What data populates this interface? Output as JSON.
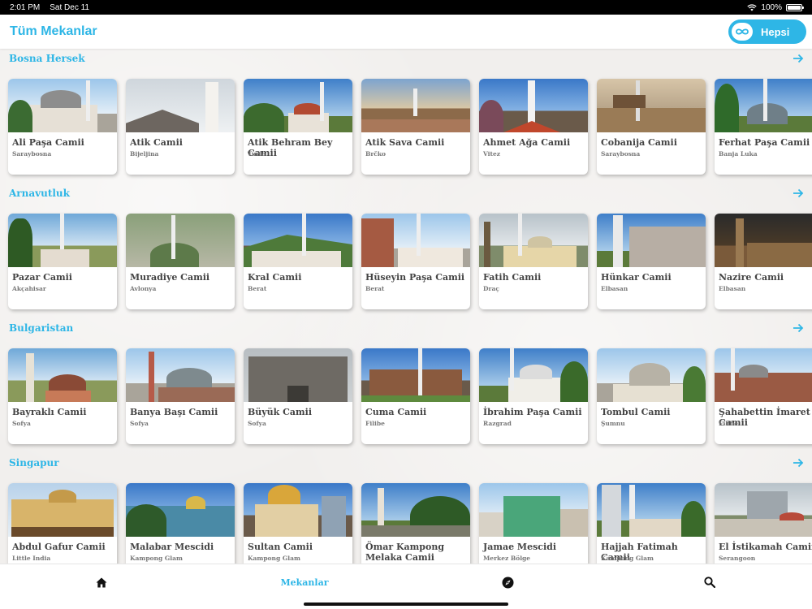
{
  "status": {
    "time": "2:01 PM",
    "date": "Sat Dec 11",
    "battery": "100%"
  },
  "header": {
    "title": "Tüm Mekanlar",
    "all_label": "Hepsi"
  },
  "accent": "#2eb6e6",
  "sections": [
    {
      "title": "Bosna Hersek",
      "cards": [
        {
          "name": "Ali Paşa Camii",
          "location": "Saraybosna"
        },
        {
          "name": "Atik Camii",
          "location": "Bijeljina"
        },
        {
          "name": "Atik Behram Bey Camii",
          "location": "Tuzla"
        },
        {
          "name": "Atik Sava Camii",
          "location": "Brčko"
        },
        {
          "name": "Ahmet Ağa Camii",
          "location": "Vitez"
        },
        {
          "name": "Cobanija Camii",
          "location": "Saraybosna"
        },
        {
          "name": "Ferhat Paşa Camii",
          "location": "Banja Luka"
        }
      ]
    },
    {
      "title": "Arnavutluk",
      "cards": [
        {
          "name": "Pazar Camii",
          "location": "Akçahisar"
        },
        {
          "name": "Muradiye Camii",
          "location": "Avlonya"
        },
        {
          "name": "Kral Camii",
          "location": "Berat"
        },
        {
          "name": "Hüseyin Paşa Camii",
          "location": "Berat"
        },
        {
          "name": "Fatih Camii",
          "location": "Draç"
        },
        {
          "name": "Hünkar Camii",
          "location": "Elbasan"
        },
        {
          "name": "Nazire Camii",
          "location": "Elbasan"
        }
      ]
    },
    {
      "title": "Bulgaristan",
      "cards": [
        {
          "name": "Bayraklı Camii",
          "location": "Sofya"
        },
        {
          "name": "Banya Başı Camii",
          "location": "Sofya"
        },
        {
          "name": "Büyük Camii",
          "location": "Sofya"
        },
        {
          "name": "Cuma Camii",
          "location": "Filibe"
        },
        {
          "name": "İbrahim Paşa Camii",
          "location": "Razgrad"
        },
        {
          "name": "Tombul Camii",
          "location": "Şumnu"
        },
        {
          "name": "Şahabettin İmaret Camii",
          "location": "Filibe"
        }
      ]
    },
    {
      "title": "Singapur",
      "cards": [
        {
          "name": "Abdul Gafur Camii",
          "location": "Little India"
        },
        {
          "name": "Malabar Mescidi",
          "location": "Kampong Glam"
        },
        {
          "name": "Sultan Camii",
          "location": "Kampong Glam"
        },
        {
          "name": "Ömar Kampong Melaka Camii",
          "location": ""
        },
        {
          "name": "Jamae Mescidi",
          "location": "Merkez Bölge"
        },
        {
          "name": "Hajjah Fatimah Camii",
          "location": "Kampong Glam"
        },
        {
          "name": "El İstikamah Camii",
          "location": "Serangoon"
        }
      ]
    }
  ],
  "tabs": [
    {
      "icon": "home-icon",
      "label": ""
    },
    {
      "icon": "",
      "label": "Mekanlar"
    },
    {
      "icon": "compass-icon",
      "label": ""
    },
    {
      "icon": "search-icon",
      "label": ""
    }
  ]
}
